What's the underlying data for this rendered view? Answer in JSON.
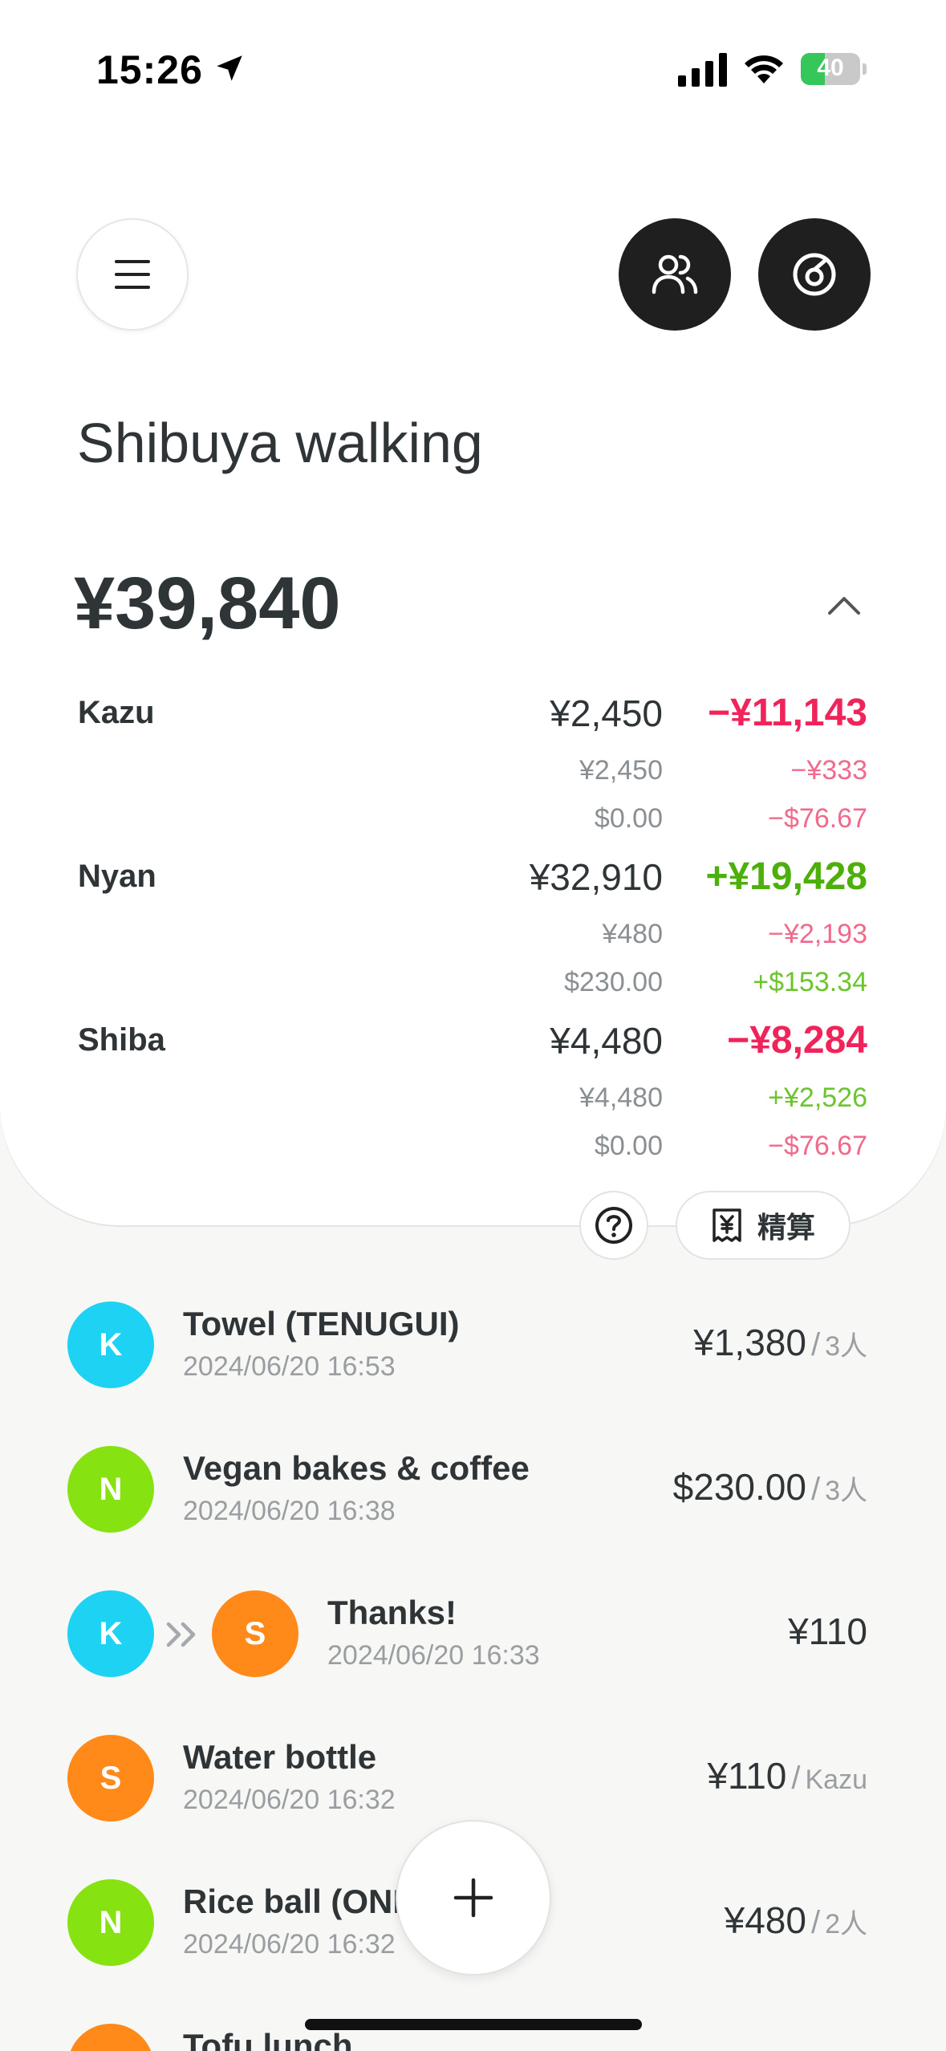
{
  "status": {
    "time": "15:26",
    "battery": "40",
    "battery_level": 0.4
  },
  "header": {
    "title": "Shibuya walking"
  },
  "summary": {
    "total": "¥39,840"
  },
  "members": [
    {
      "name": "Kazu",
      "paid": "¥2,450",
      "balance": "−¥11,143",
      "sub": [
        {
          "paid": "¥2,450",
          "balance": "−¥333"
        },
        {
          "paid": "$0.00",
          "balance": "−$76.67"
        }
      ]
    },
    {
      "name": "Nyan",
      "paid": "¥32,910",
      "balance": "+¥19,428",
      "sub": [
        {
          "paid": "¥480",
          "balance": "−¥2,193"
        },
        {
          "paid": "$230.00",
          "balance": "+$153.34"
        }
      ]
    },
    {
      "name": "Shiba",
      "paid": "¥4,480",
      "balance": "−¥8,284",
      "sub": [
        {
          "paid": "¥4,480",
          "balance": "+¥2,526"
        },
        {
          "paid": "$0.00",
          "balance": "−$76.67"
        }
      ]
    }
  ],
  "actions": {
    "settle_label": "精算"
  },
  "transactions": [
    {
      "avatar": "K",
      "title": "Towel (TENUGUI)",
      "date": "2024/06/20 16:53",
      "amount": "¥1,380",
      "split": "3人"
    },
    {
      "avatar": "N",
      "title": "Vegan bakes & coffee",
      "date": "2024/06/20 16:38",
      "amount": "$230.00",
      "split": "3人"
    },
    {
      "avatar": "K",
      "avatar_to": "S",
      "title": "Thanks!",
      "date": "2024/06/20 16:33",
      "amount": "¥110",
      "split": ""
    },
    {
      "avatar": "S",
      "title": "Water bottle",
      "date": "2024/06/20 16:32",
      "amount": "¥110",
      "split": "Kazu"
    },
    {
      "avatar": "N",
      "title": "Rice ball (ONI",
      "date": "2024/06/20 16:32",
      "amount": "¥480",
      "split": "2人"
    },
    {
      "avatar": "S",
      "title": "Tofu lunch",
      "date": "",
      "amount": "",
      "split": ""
    }
  ]
}
